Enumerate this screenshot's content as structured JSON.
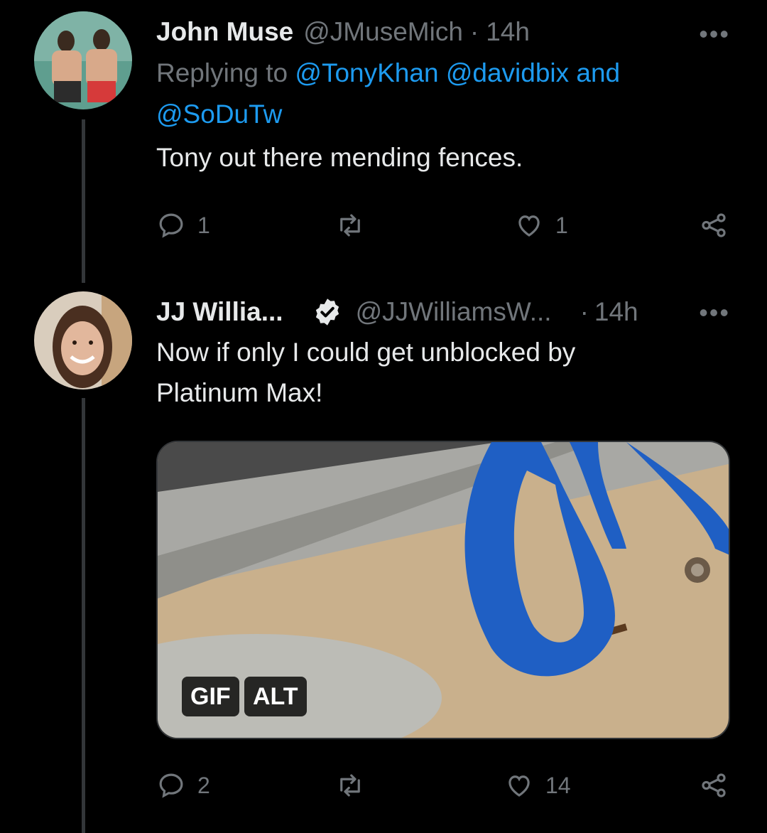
{
  "tweets": [
    {
      "name": "John Muse",
      "handle": "@JMuseMich",
      "dot": "·",
      "time": "14h",
      "replying_prefix": "Replying to",
      "replying_users": [
        "@TonyKhan",
        "@davidbix"
      ],
      "replying_and": "and",
      "replying_last": "@SoDuTw",
      "text": "Tony out there mending fences.",
      "replies": "1",
      "retweets": "",
      "likes": "1"
    },
    {
      "name": "JJ Willia...",
      "handle": "@JJWilliamsW...",
      "dot": "·",
      "time": "14h",
      "text_line1": "Now if only I could get unblocked by",
      "text_line2": "Platinum Max!",
      "media_badges": [
        "GIF",
        "ALT"
      ],
      "replies": "2",
      "retweets": "",
      "likes": "14"
    }
  ],
  "more_label": "•••",
  "colors": {
    "background": "#000000",
    "text": "#e7e9ea",
    "muted": "#71767b",
    "link": "#1d9bf0",
    "thread_line": "#333639"
  }
}
